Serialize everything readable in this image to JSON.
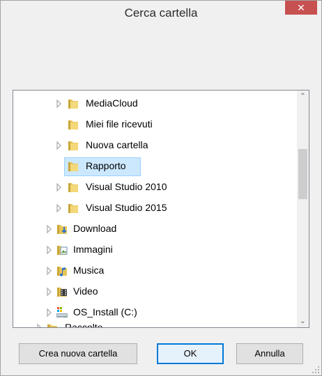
{
  "dialog": {
    "title": "Cerca cartella",
    "close_glyph": "✕"
  },
  "tree": {
    "items": [
      {
        "label": "MediaCloud",
        "icon": "folder-icon",
        "expandable": true
      },
      {
        "label": "Miei file ricevuti",
        "icon": "folder-icon",
        "expandable": false
      },
      {
        "label": "Nuova cartella",
        "icon": "folder-icon",
        "expandable": true
      },
      {
        "label": "Rapporto",
        "icon": "folder-icon",
        "expandable": false,
        "selected": true
      },
      {
        "label": "Visual Studio 2010",
        "icon": "folder-icon",
        "expandable": true
      },
      {
        "label": "Visual Studio 2015",
        "icon": "folder-icon",
        "expandable": true
      },
      {
        "label": "Download",
        "icon": "download-folder-icon",
        "expandable": true
      },
      {
        "label": "Immagini",
        "icon": "pictures-folder-icon",
        "expandable": true
      },
      {
        "label": "Musica",
        "icon": "music-folder-icon",
        "expandable": true
      },
      {
        "label": "Video",
        "icon": "video-folder-icon",
        "expandable": true
      },
      {
        "label": "OS_Install (C:)",
        "icon": "drive-icon",
        "expandable": true
      },
      {
        "label": "Raccolte",
        "icon": "libraries-folder-icon",
        "expandable": true
      }
    ]
  },
  "buttons": {
    "new_folder": "Crea nuova cartella",
    "ok": "OK",
    "cancel": "Annulla"
  },
  "colors": {
    "selection": "#cce8ff",
    "close": "#c75050",
    "folder": "#e8c55a",
    "default_border": "#0078d7"
  }
}
